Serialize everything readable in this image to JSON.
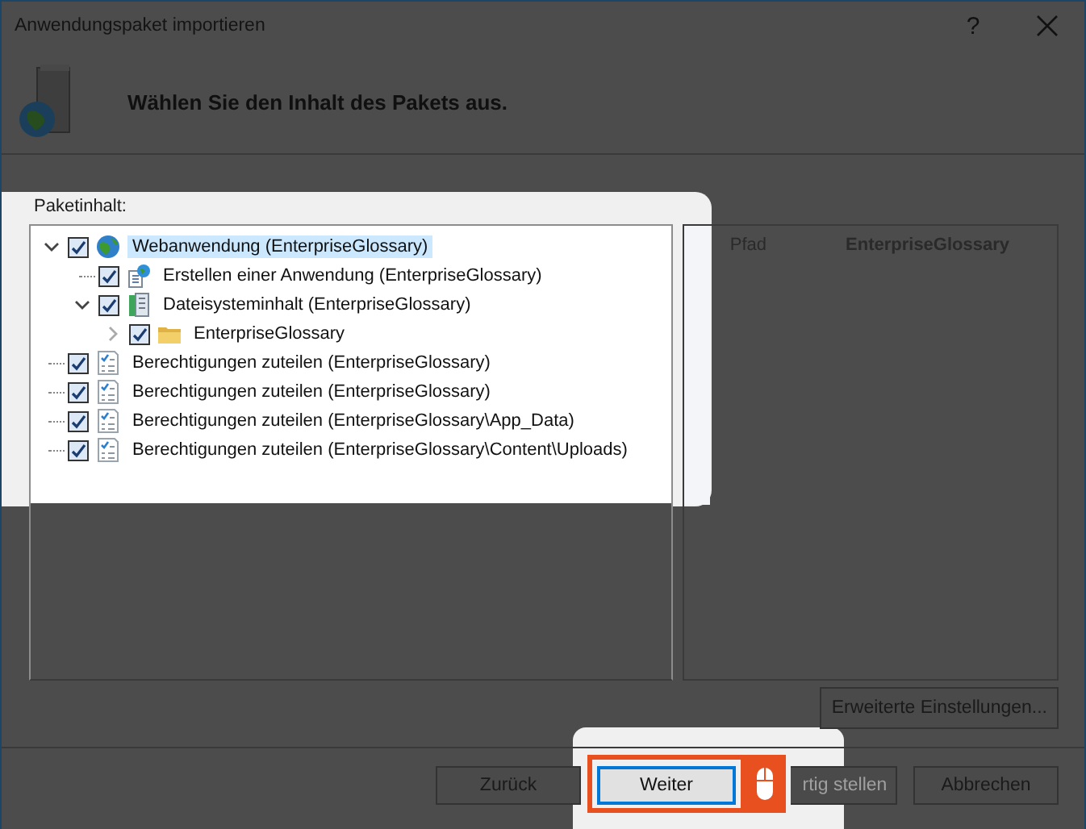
{
  "window": {
    "title": "Anwendungspaket importieren",
    "help": "?"
  },
  "heading": "Wählen Sie den Inhalt des Pakets aus.",
  "content_label": "Paketinhalt:",
  "tree": [
    {
      "label": "Webanwendung (EnterpriseGlossary)",
      "kind": "web",
      "checked": true,
      "selected": true,
      "expanded": true,
      "children": [
        {
          "label": "Erstellen einer Anwendung (EnterpriseGlossary)",
          "kind": "app",
          "checked": true,
          "selected": false
        },
        {
          "label": "Dateisysteminhalt (EnterpriseGlossary)",
          "kind": "files",
          "checked": true,
          "selected": false,
          "expanded": true,
          "children": [
            {
              "label": "EnterpriseGlossary",
              "kind": "folder",
              "checked": true,
              "selected": false,
              "expanded": false
            }
          ]
        }
      ]
    },
    {
      "label": "Berechtigungen zuteilen (EnterpriseGlossary)",
      "kind": "checklist",
      "checked": true,
      "selected": false
    },
    {
      "label": "Berechtigungen zuteilen (EnterpriseGlossary)",
      "kind": "checklist",
      "checked": true,
      "selected": false
    },
    {
      "label": "Berechtigungen zuteilen (EnterpriseGlossary\\App_Data)",
      "kind": "checklist",
      "checked": true,
      "selected": false
    },
    {
      "label": "Berechtigungen zuteilen (EnterpriseGlossary\\Content\\Uploads)",
      "kind": "checklist",
      "checked": true,
      "selected": false
    }
  ],
  "details": {
    "columns": [
      "Pfad",
      "EnterpriseGlossary"
    ]
  },
  "advanced_button": "Erweiterte Einstellungen...",
  "buttons": [
    {
      "label": "Zurück",
      "disabled": false,
      "focused": false,
      "highlighted": false
    },
    {
      "label": "Weiter",
      "disabled": false,
      "focused": true,
      "highlighted": true
    },
    {
      "label": "rtig stellen",
      "disabled": true,
      "focused": false,
      "highlighted": false
    },
    {
      "label": "Abbrechen",
      "disabled": false,
      "focused": false,
      "highlighted": false
    }
  ]
}
